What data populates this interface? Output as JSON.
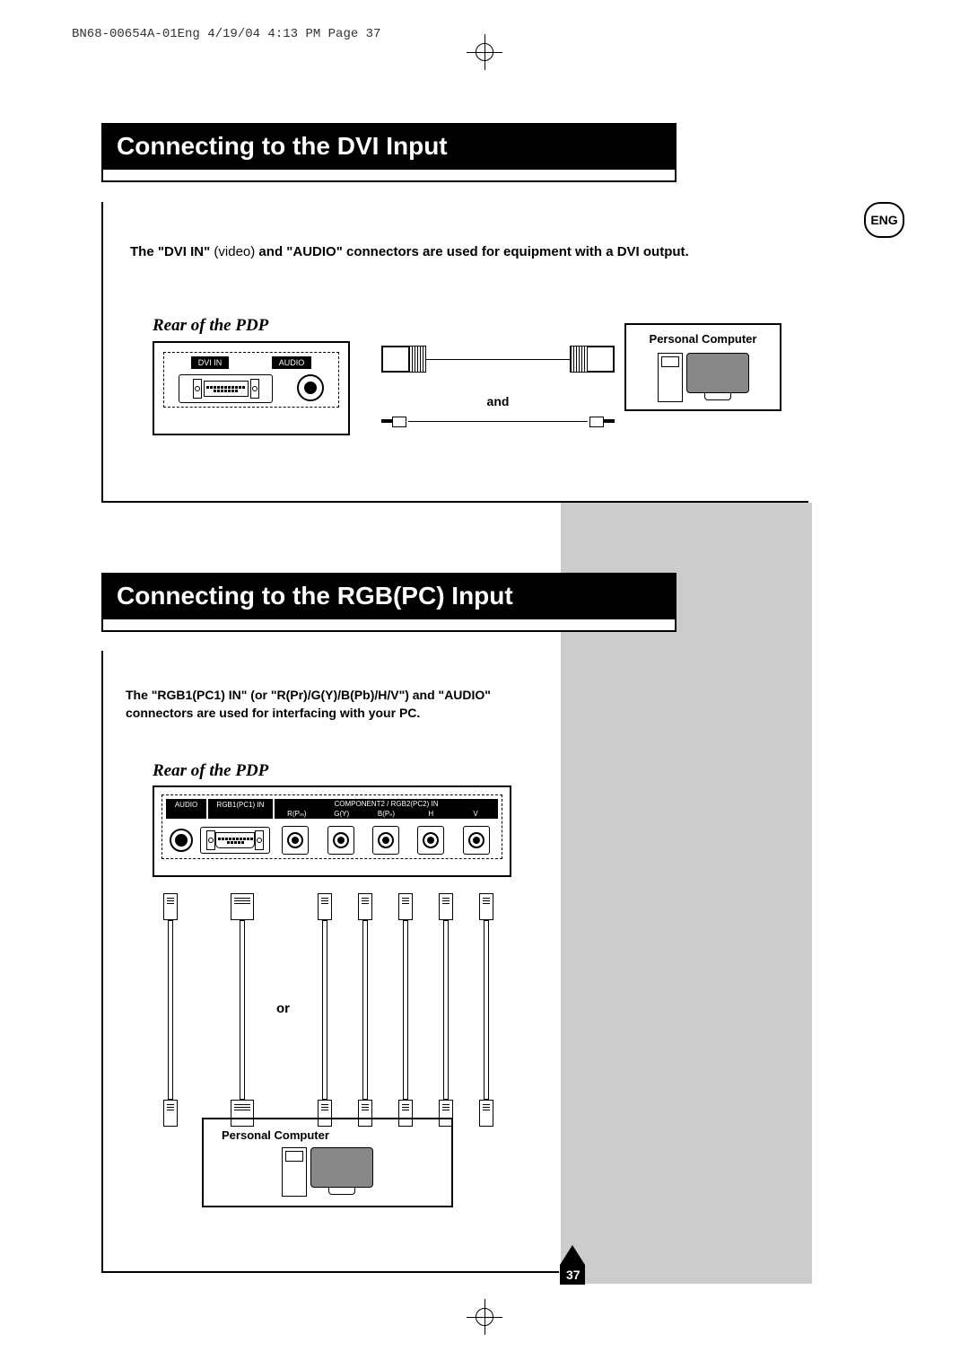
{
  "header_line": "BN68-00654A-01Eng  4/19/04  4:13 PM  Page 37",
  "lang_badge": "ENG",
  "page_number": "37",
  "section1": {
    "title": "Connecting to the DVI Input",
    "intro_pre": "The \"DVI IN\" ",
    "intro_mid": "(video)",
    "intro_post": " and \"AUDIO\" connectors are used for equipment with a DVI output.",
    "rear_label": "Rear of the PDP",
    "port_dvi": "DVI IN",
    "port_audio": "AUDIO",
    "and_label": "and",
    "pc_label": "Personal Computer"
  },
  "section2": {
    "title": "Connecting to the RGB(PC) Input",
    "intro": "The \"RGB1(PC1) IN\" (or \"R(Pr)/G(Y)/B(Pb)/H/V\") and \"AUDIO\" connectors are used for interfacing with your PC.",
    "rear_label": "Rear of the PDP",
    "port_audio": "AUDIO",
    "port_rgb1": "RGB1(PC1) IN",
    "port_comp_header": "COMPONENT2 / RGB2(PC2) IN",
    "port_r": "R(Pₘ)",
    "port_g": "G(Y)",
    "port_b": "B(Pₙ)",
    "port_h": "H",
    "port_v": "V",
    "or_label": "or",
    "pc_label": "Personal Computer"
  }
}
